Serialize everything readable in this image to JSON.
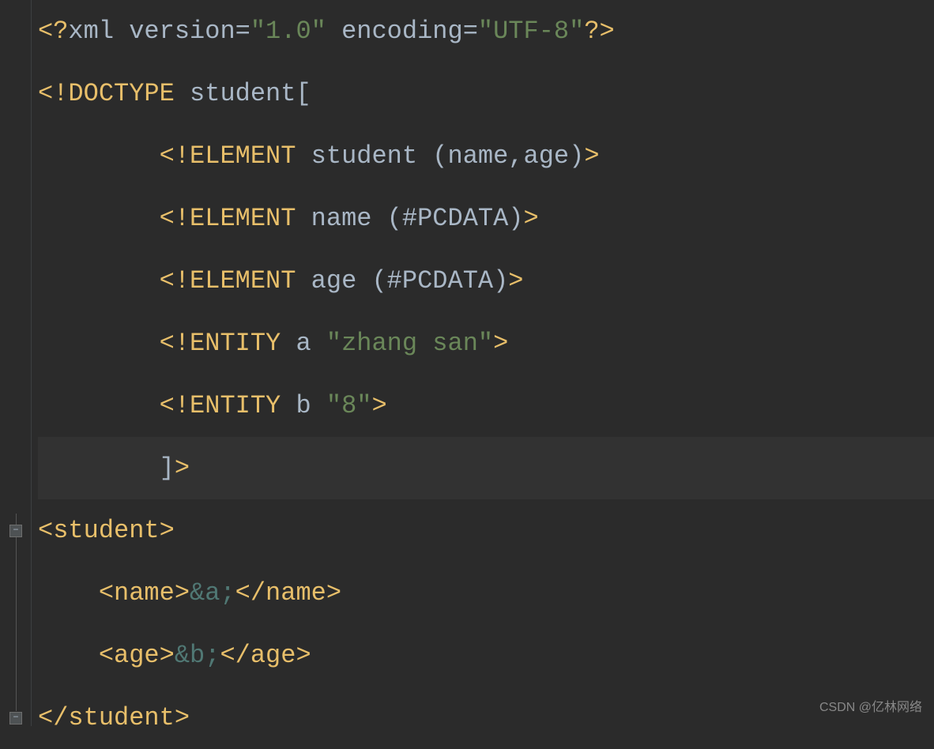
{
  "code": {
    "lines": [
      {
        "segments": [
          {
            "text": "<?",
            "class": "tag-bracket"
          },
          {
            "text": "xml version",
            "class": "attr-name"
          },
          {
            "text": "=",
            "class": "attr-name"
          },
          {
            "text": "\"1.0\"",
            "class": "string"
          },
          {
            "text": " encoding",
            "class": "attr-name"
          },
          {
            "text": "=",
            "class": "attr-name"
          },
          {
            "text": "\"UTF-8\"",
            "class": "string"
          },
          {
            "text": "?>",
            "class": "tag-bracket"
          }
        ],
        "current": false
      },
      {
        "segments": [
          {
            "text": "<!DOCTYPE ",
            "class": "doctype"
          },
          {
            "text": "student",
            "class": "content"
          },
          {
            "text": "[",
            "class": "content"
          }
        ],
        "current": false
      },
      {
        "segments": [
          {
            "text": "        <!ELEMENT ",
            "class": "element-kw"
          },
          {
            "text": "student ",
            "class": "content"
          },
          {
            "text": "(",
            "class": "paren"
          },
          {
            "text": "name,age",
            "class": "content"
          },
          {
            "text": ")",
            "class": "paren"
          },
          {
            "text": ">",
            "class": "tag-bracket"
          }
        ],
        "current": false
      },
      {
        "segments": [
          {
            "text": "        <!ELEMENT ",
            "class": "element-kw"
          },
          {
            "text": "name ",
            "class": "content"
          },
          {
            "text": "(",
            "class": "paren"
          },
          {
            "text": "#PCDATA",
            "class": "content"
          },
          {
            "text": ")",
            "class": "paren"
          },
          {
            "text": ">",
            "class": "tag-bracket"
          }
        ],
        "current": false
      },
      {
        "segments": [
          {
            "text": "        <!ELEMENT ",
            "class": "element-kw"
          },
          {
            "text": "age ",
            "class": "content"
          },
          {
            "text": "(",
            "class": "paren"
          },
          {
            "text": "#PCDATA",
            "class": "content"
          },
          {
            "text": ")",
            "class": "paren"
          },
          {
            "text": ">",
            "class": "tag-bracket"
          }
        ],
        "current": false
      },
      {
        "segments": [
          {
            "text": "        <!ENTITY ",
            "class": "entity-kw"
          },
          {
            "text": "a ",
            "class": "content"
          },
          {
            "text": "\"zhang san\"",
            "class": "string"
          },
          {
            "text": ">",
            "class": "tag-bracket"
          }
        ],
        "current": false
      },
      {
        "segments": [
          {
            "text": "        <!ENTITY ",
            "class": "entity-kw"
          },
          {
            "text": "b ",
            "class": "content"
          },
          {
            "text": "\"8\"",
            "class": "string"
          },
          {
            "text": ">",
            "class": "tag-bracket"
          }
        ],
        "current": false
      },
      {
        "segments": [
          {
            "text": "        ]",
            "class": "content"
          },
          {
            "text": ">",
            "class": "tag-bracket"
          }
        ],
        "current": true
      },
      {
        "segments": [
          {
            "text": "<student>",
            "class": "tag-name"
          }
        ],
        "current": false
      },
      {
        "segments": [
          {
            "text": "    ",
            "class": "content"
          },
          {
            "text": "<name>",
            "class": "tag-name"
          },
          {
            "text": "&a;",
            "class": "entity-ref"
          },
          {
            "text": "</name>",
            "class": "tag-name"
          }
        ],
        "current": false
      },
      {
        "segments": [
          {
            "text": "    ",
            "class": "content"
          },
          {
            "text": "<age>",
            "class": "tag-name"
          },
          {
            "text": "&b;",
            "class": "entity-ref"
          },
          {
            "text": "</age>",
            "class": "tag-name"
          }
        ],
        "current": false
      },
      {
        "segments": [
          {
            "text": "</student>",
            "class": "tag-name"
          }
        ],
        "current": false
      }
    ]
  },
  "fold_markers": [
    {
      "line_index": 8,
      "symbol": "−"
    },
    {
      "line_index": 11,
      "symbol": "−"
    }
  ],
  "watermark": "CSDN @亿林网络"
}
